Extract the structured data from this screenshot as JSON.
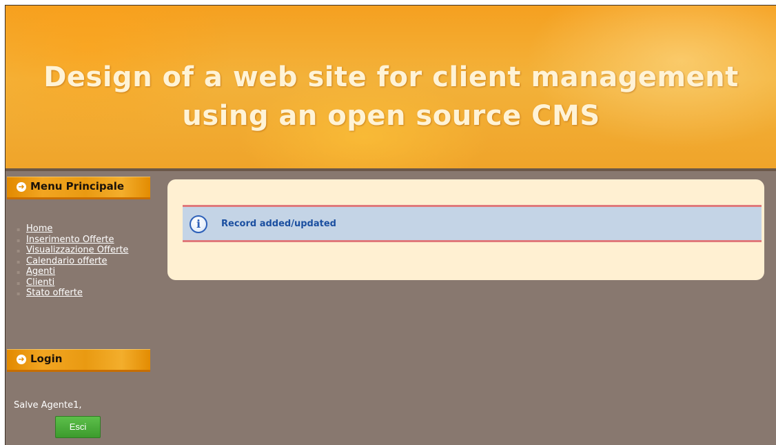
{
  "banner": {
    "title_line1": "Design of a web site for client management",
    "title_line2": "using an open source CMS"
  },
  "main_menu": {
    "header": "Menu Principale",
    "items": [
      {
        "label": "Home"
      },
      {
        "label": "Inserimento Offerte"
      },
      {
        "label": "Visualizzazione Offerte"
      },
      {
        "label": "Calendario offerte"
      },
      {
        "label": "Agenti"
      },
      {
        "label": "Clienti"
      },
      {
        "label": "Stato offerte"
      }
    ]
  },
  "login": {
    "header": "Login",
    "greeting": "Salve Agente1,",
    "logout_label": "Esci"
  },
  "message": {
    "text": "Record added/updated",
    "icon": "info-icon"
  },
  "colors": {
    "background": "#88786f",
    "banner": "#f5a020",
    "content_box": "#fff0d2",
    "message_bg": "#c4d4e6",
    "message_border": "#e0787a",
    "message_text": "#1b4fa0",
    "logout_button": "#4caf3a"
  }
}
